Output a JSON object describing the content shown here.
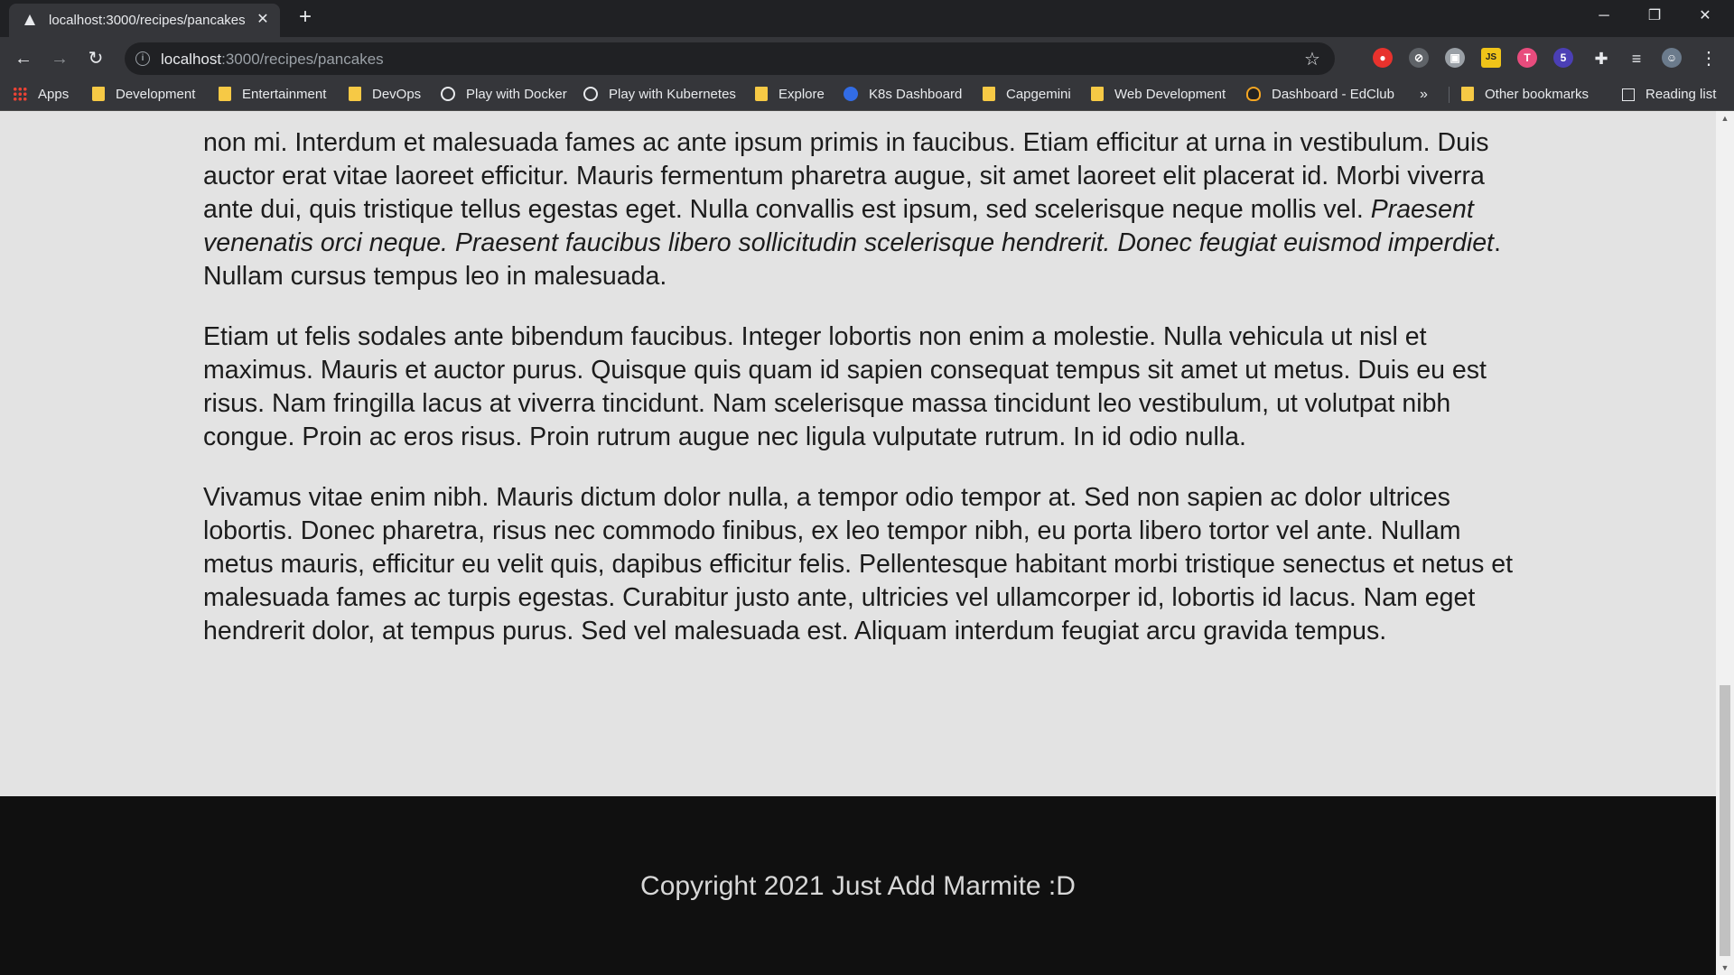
{
  "browser": {
    "tab_title": "localhost:3000/recipes/pancakes",
    "tab_close": "✕",
    "new_tab": "+",
    "url_host": "localhost",
    "url_rest": ":3000/recipes/pancakes",
    "window_controls": [
      "─",
      "❐",
      "✕"
    ],
    "extensions": [
      {
        "icon": "record-icon",
        "color": "#e8322d",
        "glyph": "●"
      },
      {
        "icon": "block-icon",
        "color": "#5f6368",
        "glyph": "⊘"
      },
      {
        "icon": "screen-icon",
        "color": "#9aa0a6",
        "glyph": "▣"
      },
      {
        "icon": "js-icon",
        "color": "#f0c419",
        "glyph": "JS"
      },
      {
        "icon": "t-icon",
        "color": "#e84c7d",
        "glyph": "T"
      },
      {
        "icon": "badge-icon",
        "color": "#4b3fb5",
        "glyph": "5"
      }
    ],
    "bookmarks": [
      {
        "label": "Apps",
        "icon": "apps"
      },
      {
        "label": "Development",
        "icon": "folder"
      },
      {
        "label": "Entertainment",
        "icon": "folder"
      },
      {
        "label": "DevOps",
        "icon": "folder"
      },
      {
        "label": "Play with Docker",
        "icon": "globe"
      },
      {
        "label": "Play with Kubernetes",
        "icon": "globe"
      },
      {
        "label": "Explore",
        "icon": "folder"
      },
      {
        "label": "K8s Dashboard",
        "icon": "k8s"
      },
      {
        "label": "Capgemini",
        "icon": "folder"
      },
      {
        "label": "Web Development",
        "icon": "folder"
      },
      {
        "label": "Dashboard - EdClub",
        "icon": "edclub"
      }
    ],
    "more_bookmarks": "»",
    "other_bookmarks": "Other bookmarks",
    "reading_list": "Reading list"
  },
  "page": {
    "paragraphs": [
      {
        "before": "non mi. Interdum et malesuada fames ac ante ipsum primis in faucibus. Etiam efficitur at urna in vestibulum. Duis auctor erat vitae laoreet efficitur. Mauris fermentum pharetra augue, sit amet laoreet elit placerat id. Morbi viverra ante dui, quis tristique tellus egestas eget. Nulla convallis est ipsum, sed scelerisque neque mollis vel. ",
        "italic": "Praesent venenatis orci neque. Praesent faucibus libero sollicitudin scelerisque hendrerit. Donec feugiat euismod imperdiet",
        "after": ". Nullam cursus tempus leo in malesuada."
      },
      {
        "before": "Etiam ut felis sodales ante bibendum faucibus. Integer lobortis non enim a molestie. Nulla vehicula ut nisl et maximus. Mauris et auctor purus. Quisque quis quam id sapien consequat tempus sit amet ut metus. Duis eu est risus. Nam fringilla lacus at viverra tincidunt. Nam scelerisque massa tincidunt leo vestibulum, ut volutpat nibh congue. Proin ac eros risus. Proin rutrum augue nec ligula vulputate rutrum. In id odio nulla.",
        "italic": "",
        "after": ""
      },
      {
        "before": "Vivamus vitae enim nibh. Mauris dictum dolor nulla, a tempor odio tempor at. Sed non sapien ac dolor ultrices lobortis. Donec pharetra, risus nec commodo finibus, ex leo tempor nibh, eu porta libero tortor vel ante. Nullam metus mauris, efficitur eu velit quis, dapibus efficitur felis. Pellentesque habitant morbi tristique senectus et netus et malesuada fames ac turpis egestas. Curabitur justo ante, ultricies vel ullamcorper id, lobortis id lacus. Nam eget hendrerit dolor, at tempus purus. Sed vel malesuada est. Aliquam interdum feugiat arcu gravida tempus.",
        "italic": "",
        "after": ""
      }
    ],
    "footer_text": "Copyright 2021 Just Add Marmite :D"
  },
  "colors": {
    "page_bg": "#e3e3e3",
    "footer_bg": "#101010",
    "chrome_dark": "#202124",
    "chrome": "#35363a"
  }
}
